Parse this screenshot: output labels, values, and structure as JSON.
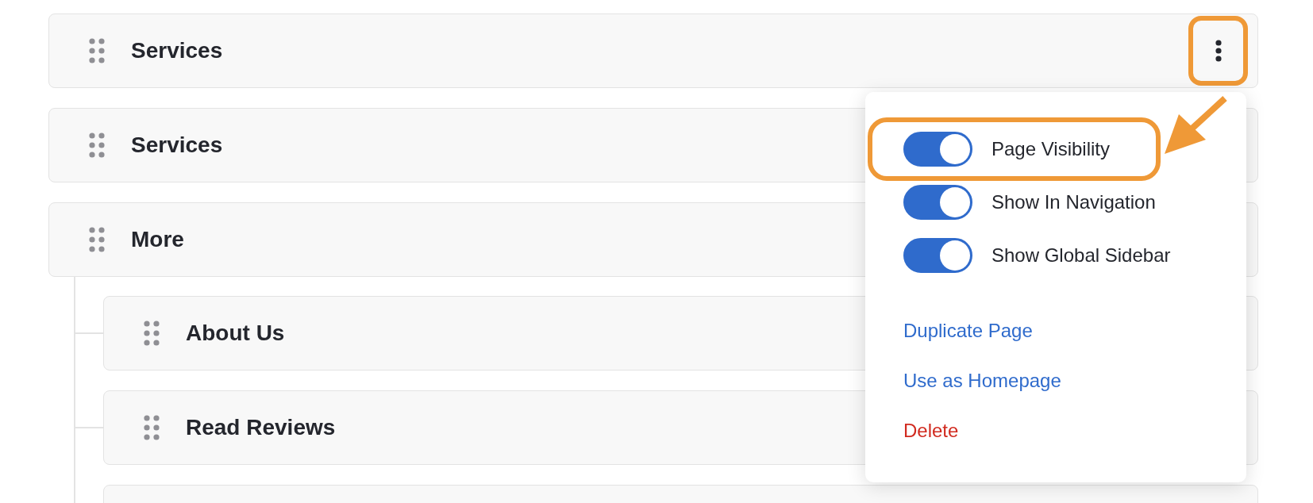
{
  "pages": [
    {
      "title": "Services",
      "menu_button": {
        "highlighted": true
      }
    },
    {
      "title": "Services"
    },
    {
      "title": "More",
      "children": [
        {
          "kind": "row",
          "title": "About Us"
        },
        {
          "kind": "row",
          "title": "Read Reviews"
        },
        {
          "kind": "row"
        }
      ]
    }
  ],
  "menu": {
    "toggles": [
      {
        "label": "Page Visibility",
        "on": true,
        "highlighted": true
      },
      {
        "label": "Show In Navigation",
        "on": true,
        "highlighted": false
      },
      {
        "label": "Show Global Sidebar",
        "on": true,
        "highlighted": false
      }
    ],
    "actions": [
      {
        "label": "Duplicate Page",
        "kind": "link"
      },
      {
        "label": "Use as Homepage",
        "kind": "link"
      },
      {
        "label": "Delete",
        "kind": "danger"
      }
    ],
    "callout_arrow": true
  }
}
